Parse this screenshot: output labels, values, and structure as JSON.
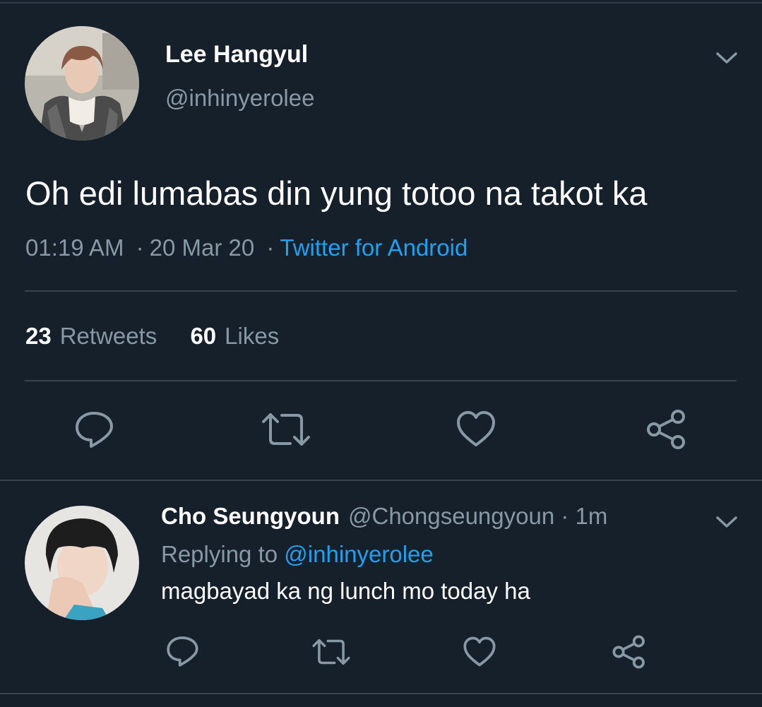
{
  "colors": {
    "background": "#15202b",
    "primary_text": "#ffffff",
    "secondary_text": "#8899a6",
    "accent": "#1da1f2",
    "divider": "#38444d"
  },
  "main_tweet": {
    "author_name": "Lee Hangyul",
    "author_handle": "@inhinyerolee",
    "text": "Oh edi lumabas din yung totoo na takot ka",
    "time": "01:19 AM",
    "date": "20 Mar 20",
    "separator": "·",
    "source": "Twitter for Android",
    "stats": {
      "retweets_count": "23",
      "retweets_label": "Retweets",
      "likes_count": "60",
      "likes_label": "Likes"
    },
    "actions": [
      "reply-icon",
      "retweet-icon",
      "like-icon",
      "share-icon"
    ]
  },
  "reply_tweet": {
    "author_name": "Cho Seungyoun",
    "author_handle": "@Chongseungyoun",
    "time": "· 1m",
    "replying_label": "Replying to",
    "replying_mention": "@inhinyerolee",
    "text": "magbayad ka ng lunch mo today ha",
    "actions": [
      "reply-icon",
      "retweet-icon",
      "like-icon",
      "share-icon"
    ]
  }
}
